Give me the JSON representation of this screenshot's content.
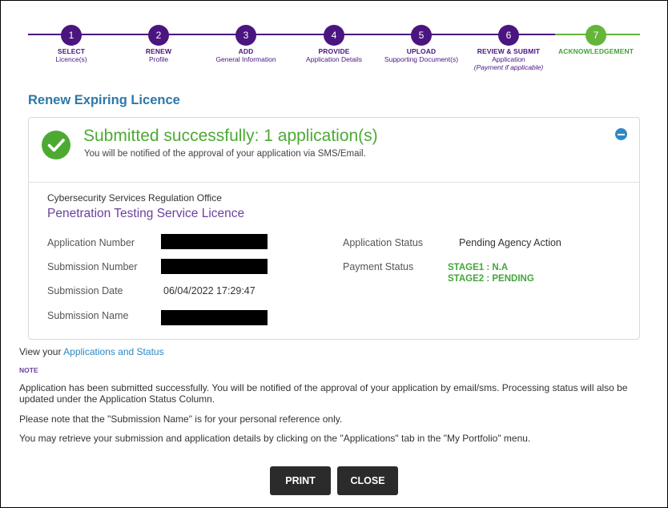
{
  "stepper": {
    "done_color": "#4b1580",
    "current_color": "#64b53a",
    "steps": [
      {
        "num": "1",
        "label": "SELECT",
        "sub": "Licence(s)",
        "note": ""
      },
      {
        "num": "2",
        "label": "RENEW",
        "sub": "Profile",
        "note": ""
      },
      {
        "num": "3",
        "label": "ADD",
        "sub": "General Information",
        "note": ""
      },
      {
        "num": "4",
        "label": "PROVIDE",
        "sub": "Application Details",
        "note": ""
      },
      {
        "num": "5",
        "label": "UPLOAD",
        "sub": "Supporting Document(s)",
        "note": ""
      },
      {
        "num": "6",
        "label": "REVIEW & SUBMIT",
        "sub": "Application",
        "note": "(Payment if applicable)"
      },
      {
        "num": "7",
        "label": "ACKNOWLEDGEMENT",
        "sub": "",
        "note": ""
      }
    ],
    "current_step": 7
  },
  "page_title": "Renew Expiring Licence",
  "result": {
    "title": "Submitted successfully: 1 application(s)",
    "subtitle": "You will be notified of the approval of your application via SMS/Email.",
    "status_icon": "check-circle-icon",
    "collapse_icon": "minus-circle-icon"
  },
  "application": {
    "agency": "Cybersecurity Services Regulation Office",
    "licence": "Penetration Testing Service Licence",
    "labels": {
      "app_number": "Application Number",
      "sub_number": "Submission Number",
      "sub_date": "Submission Date",
      "sub_name": "Submission Name",
      "app_status": "Application Status",
      "pay_status": "Payment Status"
    },
    "values": {
      "sub_date": "06/04/2022 17:29:47",
      "app_status": "Pending Agency Action",
      "pay_stage1": "STAGE1 : N.A",
      "pay_stage2": "STAGE2 : PENDING"
    }
  },
  "footer_text": {
    "view_prefix": "View your ",
    "view_link": "Applications and Status",
    "note_heading": "NOTE",
    "para1": "Application has been submitted successfully. You will be notified of the approval of your application by email/sms. Processing status will also be updated under the Application Status Column.",
    "para2": "Please note that the \"Submission Name\" is for your personal reference only.",
    "para3": "You may retrieve your submission and application details by clicking on the \"Applications\" tab in the \"My Portfolio\" menu."
  },
  "buttons": {
    "print": "PRINT",
    "close": "CLOSE"
  }
}
